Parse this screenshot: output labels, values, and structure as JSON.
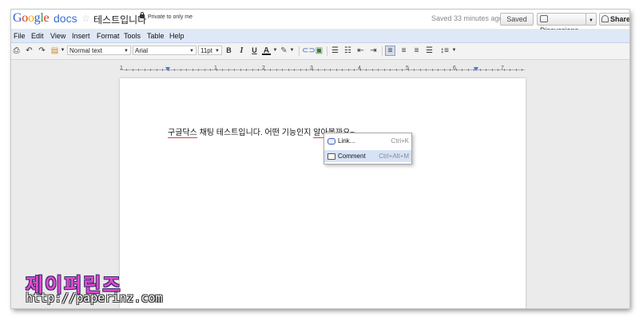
{
  "app": {
    "logo_google": "Google",
    "logo_docs": "docs",
    "doc_title": "테스트입니다",
    "privacy": "Private to only me",
    "saved_status": "Saved 33 minutes ago",
    "saved_button": "Saved",
    "discussions_button": "Discussions",
    "share_button": "Share"
  },
  "menu": {
    "items": [
      {
        "label": "File"
      },
      {
        "label": "Edit"
      },
      {
        "label": "View"
      },
      {
        "label": "Insert"
      },
      {
        "label": "Format"
      },
      {
        "label": "Tools"
      },
      {
        "label": "Table"
      },
      {
        "label": "Help"
      }
    ]
  },
  "toolbar": {
    "style_select": "Normal text",
    "font_select": "Arial",
    "size_select": "11pt",
    "bold": "B",
    "italic": "I",
    "underline": "U",
    "text_color": "A"
  },
  "ruler": {
    "numbers": [
      "1",
      "1",
      "2",
      "3",
      "4",
      "5",
      "6",
      "7"
    ]
  },
  "document": {
    "text_part1": "구글닥스",
    "text_part2": " 채팅 테스트입니다. 어떤 기능인지 ",
    "text_part3": "알아볼까요~"
  },
  "context_menu": {
    "items": [
      {
        "label": "Link...",
        "shortcut": "Ctrl+K"
      },
      {
        "label": "Comment",
        "shortcut": "Ctrl+Alt+M"
      }
    ]
  },
  "watermark": {
    "title": "제이퍼린즈",
    "url": "http://paperinz.com"
  },
  "colors": {
    "menubar_bg": "#dfe8f6",
    "accent_blue": "#3a6ecf",
    "spell_error": "#e03c3c",
    "watermark_pink": "#e24bd0"
  }
}
